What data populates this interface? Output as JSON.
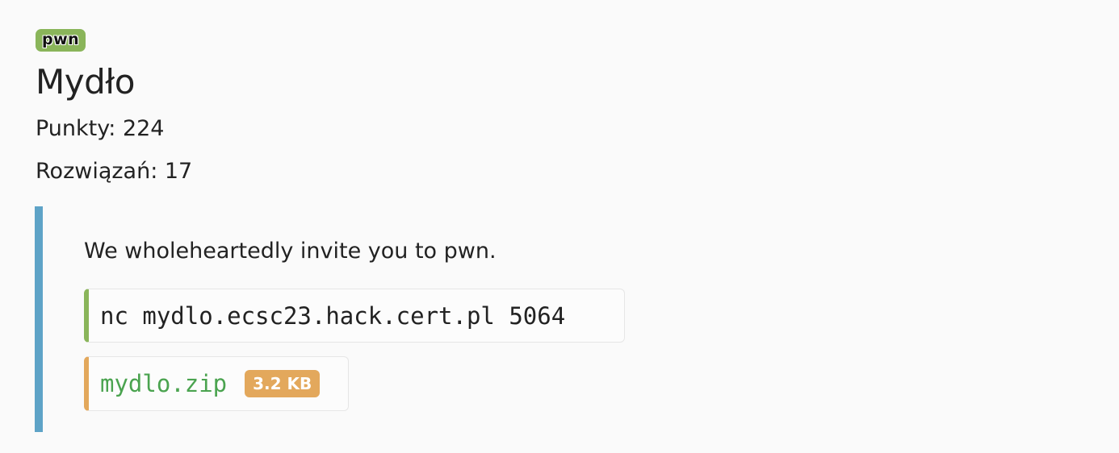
{
  "challenge": {
    "category": "pwn",
    "title": "Mydło",
    "points_label": "Punkty: 224",
    "solves_label": "Rozwiązań: 17",
    "description": "We wholeheartedly invite you to pwn.",
    "connection_command": "nc mydlo.ecsc23.hack.cert.pl 5064",
    "attachment": {
      "filename": "mydlo.zip",
      "size": "3.2 KB"
    }
  },
  "colors": {
    "category_tag": "#8ab55a",
    "description_border": "#5ea3c7",
    "code_accent": "#8ab55a",
    "file_accent": "#e3a85c",
    "file_link": "#4aa34f",
    "size_badge": "#e3a85c"
  }
}
